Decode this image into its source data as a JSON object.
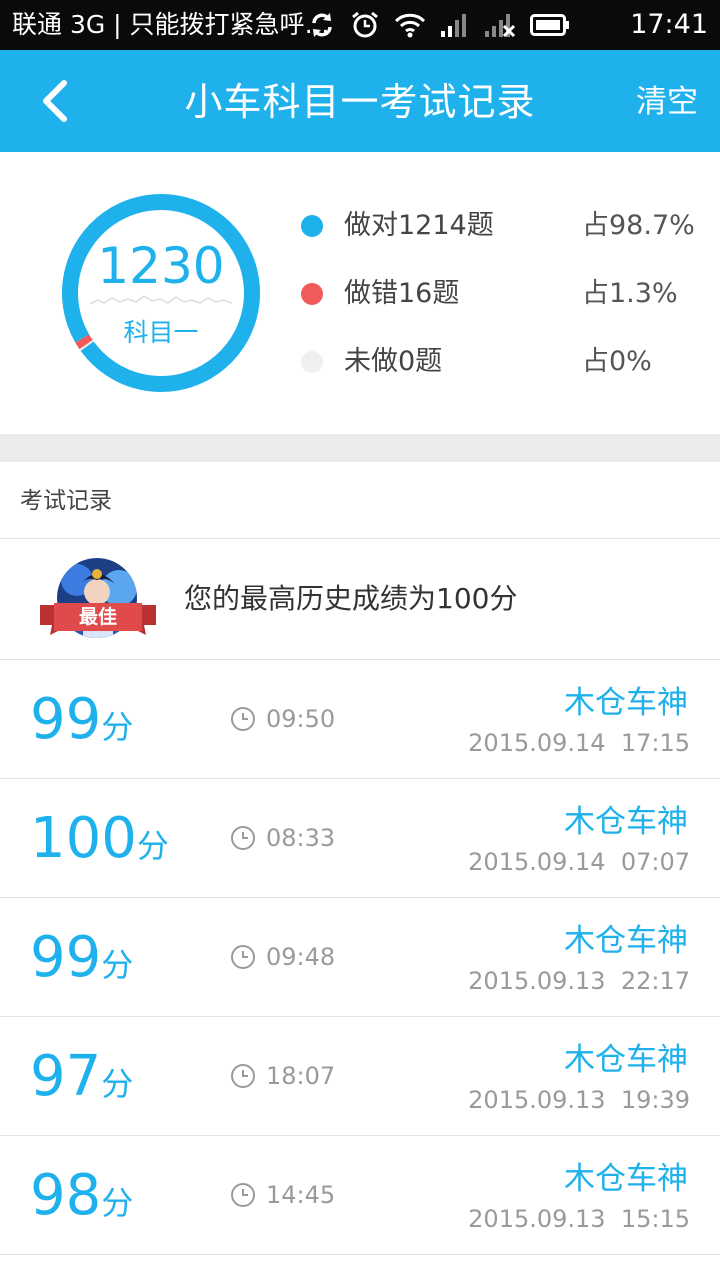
{
  "status_bar": {
    "carrier_text": "联通 3G | 只能拨打紧急呼…",
    "time": "17:41",
    "icons": [
      "sync-icon",
      "alarm-icon",
      "wifi-icon",
      "signal-icon",
      "signal-x-icon",
      "battery-icon"
    ]
  },
  "header": {
    "title": "小车科目一考试记录",
    "clear_label": "清空",
    "back_icon": "chevron-left-icon"
  },
  "summary": {
    "total": "1230",
    "subject": "科目一",
    "correct_fraction": 0.987,
    "wrong_fraction": 0.013,
    "legend": [
      {
        "label": "做对1214题",
        "percent": "占98.7%",
        "color": "#1eb1ec"
      },
      {
        "label": "做错16题",
        "percent": "占1.3%",
        "color": "#f05a5a"
      },
      {
        "label": "未做0题",
        "percent": "占0%",
        "color": "#f0f0f0"
      }
    ]
  },
  "section": {
    "title": "考试记录"
  },
  "best": {
    "badge": "最佳",
    "text": "您的最高历史成绩为100分"
  },
  "records": [
    {
      "score": "99",
      "unit": "分",
      "duration": "09:50",
      "player": "木仓车神",
      "datetime": "2015.09.14  17:15"
    },
    {
      "score": "100",
      "unit": "分",
      "duration": "08:33",
      "player": "木仓车神",
      "datetime": "2015.09.14  07:07"
    },
    {
      "score": "99",
      "unit": "分",
      "duration": "09:48",
      "player": "木仓车神",
      "datetime": "2015.09.13  22:17"
    },
    {
      "score": "97",
      "unit": "分",
      "duration": "18:07",
      "player": "木仓车神",
      "datetime": "2015.09.13  19:39"
    },
    {
      "score": "98",
      "unit": "分",
      "duration": "14:45",
      "player": "木仓车神",
      "datetime": "2015.09.13  15:15"
    }
  ],
  "colors": {
    "accent": "#1eb1ec",
    "wrong": "#f05a5a",
    "ribbon": "#e04a4a"
  }
}
